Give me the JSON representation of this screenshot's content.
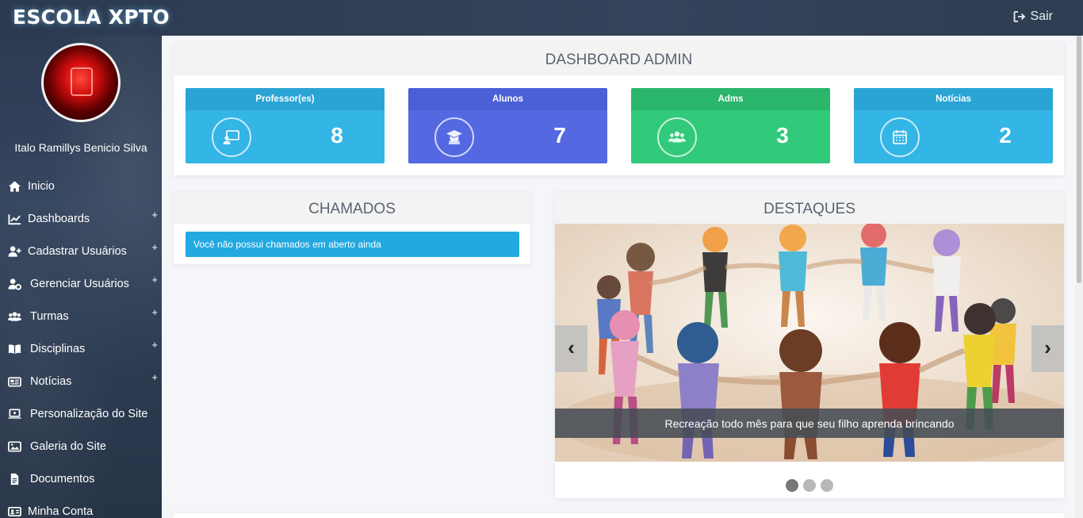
{
  "header": {
    "brand": "ESCOLA XPTO",
    "logout_label": "Sair"
  },
  "sidebar": {
    "user_name": "Italo Ramillys Benicio Silva",
    "items": [
      {
        "label": "Inicio",
        "icon": "home-icon",
        "expandable": false
      },
      {
        "label": "Dashboards",
        "icon": "chart-icon",
        "expandable": true
      },
      {
        "label": "Cadastrar Usuários",
        "icon": "user-plus-icon",
        "expandable": true
      },
      {
        "label": "Gerenciar Usuários",
        "icon": "user-gear-icon",
        "expandable": true
      },
      {
        "label": "Turmas",
        "icon": "users-icon",
        "expandable": true
      },
      {
        "label": "Disciplinas",
        "icon": "book-icon",
        "expandable": true
      },
      {
        "label": "Notícias",
        "icon": "newspaper-icon",
        "expandable": true
      },
      {
        "label": "Personalização do Site",
        "icon": "laptop-icon",
        "expandable": false
      },
      {
        "label": "Galeria do Site",
        "icon": "images-icon",
        "expandable": false
      },
      {
        "label": "Documentos",
        "icon": "file-icon",
        "expandable": false
      },
      {
        "label": "Minha Conta",
        "icon": "id-card-icon",
        "expandable": false
      }
    ],
    "expand_symbol": "+"
  },
  "dashboard": {
    "title": "DASHBOARD ADMIN",
    "cards": [
      {
        "label": "Professor(es)",
        "value": "8",
        "icon": "teacher-icon",
        "head_color": "#2aa4d4",
        "body_color": "#33b5e5"
      },
      {
        "label": "Alunos",
        "value": "7",
        "icon": "graduate-icon",
        "head_color": "#4b5fd6",
        "body_color": "#5468e2"
      },
      {
        "label": "Adms",
        "value": "3",
        "icon": "users-icon",
        "head_color": "#2ab66b",
        "body_color": "#31c97a"
      },
      {
        "label": "Notícias",
        "value": "2",
        "icon": "calendar-icon",
        "head_color": "#2aa4d4",
        "body_color": "#33b5e5"
      }
    ]
  },
  "chamados": {
    "title": "CHAMADOS",
    "message": "Você não possui chamados em aberto ainda"
  },
  "destaques": {
    "title": "DESTAQUES",
    "counter": "1 / 3",
    "caption": "Recreação todo mês para que seu filho aprenda brincando",
    "prev_symbol": "‹",
    "next_symbol": "›",
    "active_slide": 1,
    "slide_count": 3
  }
}
